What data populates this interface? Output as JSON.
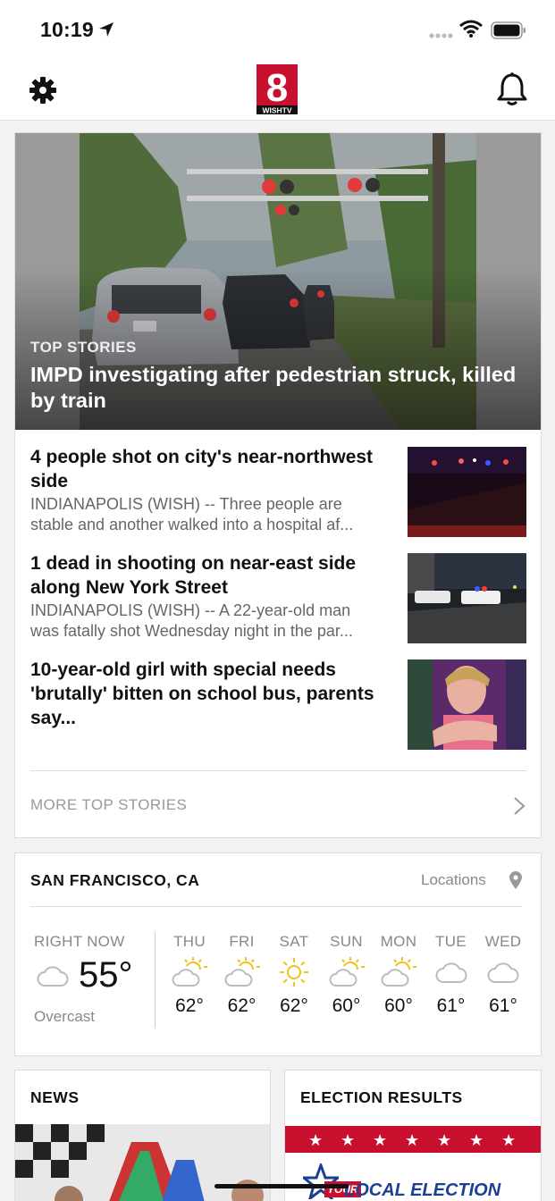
{
  "status_bar": {
    "time": "10:19"
  },
  "nav": {
    "logo_number": "8",
    "logo_text": "WISHTV"
  },
  "top_stories": {
    "hero": {
      "kicker": "TOP STORIES",
      "title": "IMPD investigating after pedestrian struck, killed by train"
    },
    "items": [
      {
        "title": "4 people shot on city's near-northwest side",
        "summary_line1": "INDIANAPOLIS (WISH) -- Three people are",
        "summary_line2": "stable and another walked into a hospital af..."
      },
      {
        "title": "1 dead in shooting on near-east side along New York Street",
        "summary_line1": "INDIANAPOLIS (WISH) -- A 22-year-old man",
        "summary_line2": "was fatally shot Wednesday night in the par..."
      },
      {
        "title": "10-year-old girl with special needs 'brutally' bitten on school bus, parents say..."
      }
    ],
    "more_label": "MORE TOP STORIES"
  },
  "weather": {
    "city": "SAN FRANCISCO, CA",
    "locations_label": "Locations",
    "now": {
      "label": "RIGHT NOW",
      "temp": "55°",
      "condition": "Overcast",
      "icon": "cloud-icon"
    },
    "days": [
      {
        "name": "THU",
        "temp": "62°",
        "icon": "partly-sunny-icon"
      },
      {
        "name": "FRI",
        "temp": "62°",
        "icon": "partly-sunny-icon"
      },
      {
        "name": "SAT",
        "temp": "62°",
        "icon": "sunny-icon"
      },
      {
        "name": "SUN",
        "temp": "60°",
        "icon": "partly-sunny-icon"
      },
      {
        "name": "MON",
        "temp": "60°",
        "icon": "partly-sunny-icon"
      },
      {
        "name": "TUE",
        "temp": "61°",
        "icon": "cloud-icon"
      },
      {
        "name": "WED",
        "temp": "61°",
        "icon": "cloud-icon"
      }
    ]
  },
  "sections": {
    "news_title": "NEWS",
    "election_title": "ELECTION RESULTS",
    "election_logo_your": "YOUR",
    "election_logo_text": "LOCAL ELECTION"
  },
  "colors": {
    "accent_red": "#c8102e",
    "election_blue": "#1c3f94",
    "sun_yellow": "#f2c21b"
  }
}
